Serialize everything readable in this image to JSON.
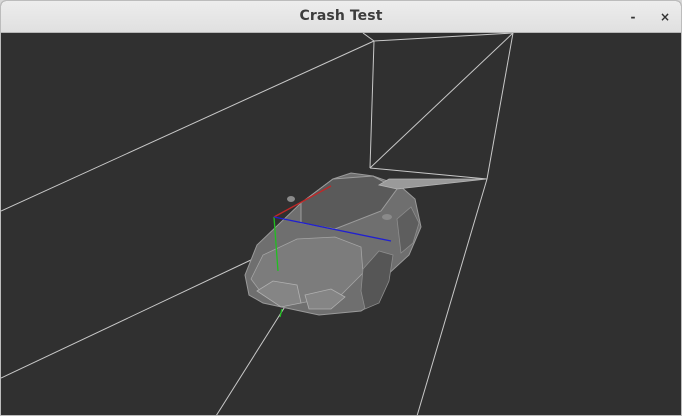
{
  "window": {
    "title": "Crash Test",
    "minimize_glyph": "-",
    "close_glyph": "×"
  },
  "scene": {
    "background_color": "#303030",
    "grid_line_color": "#c8c8c8",
    "car_color": "#8a8a8a",
    "axis_colors": {
      "x": "#c02828",
      "y": "#20c020",
      "z": "#2020d0"
    }
  }
}
